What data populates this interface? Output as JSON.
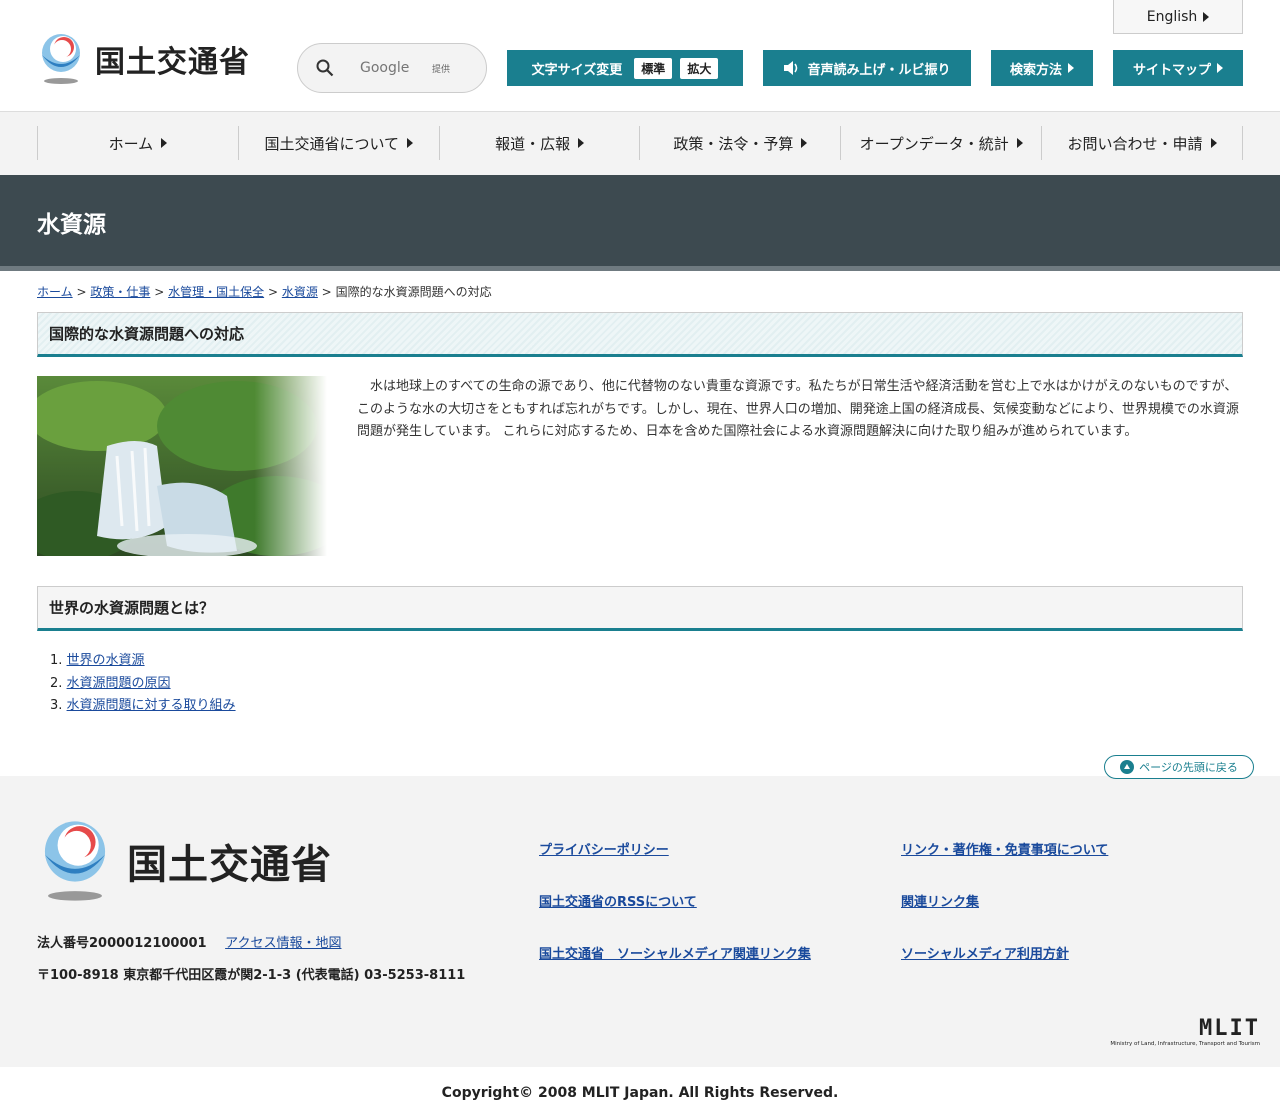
{
  "header": {
    "logo_text": "国土交通省",
    "english_label": "English",
    "search_placeholder": "Google",
    "search_provided": "提供",
    "font_size_label": "文字サイズ変更",
    "font_standard": "標準",
    "font_large": "拡大",
    "speech_label": "音声読み上げ・ルビ振り",
    "search_method_label": "検索方法",
    "sitemap_label": "サイトマップ"
  },
  "gnav": [
    {
      "label": "ホーム"
    },
    {
      "label": "国土交通省について"
    },
    {
      "label": "報道・広報"
    },
    {
      "label": "政策・法令・予算"
    },
    {
      "label": "オープンデータ・統計"
    },
    {
      "label": "お問い合わせ・申請"
    }
  ],
  "page_title": "水資源",
  "breadcrumb": {
    "items": [
      "ホーム",
      "政策・仕事",
      "水管理・国土保全",
      "水資源"
    ],
    "separator": ">",
    "current": "国際的な水資源問題への対応"
  },
  "section1": {
    "heading": "国際的な水資源問題への対応",
    "body": "水は地球上のすべての生命の源であり、他に代替物のない貴重な資源です。私たちが日常生活や経済活動を営む上で水はかけがえのないものですが、このような水の大切さをともすれば忘れがちです。しかし、現在、世界人口の増加、開発途上国の経済成長、気候変動などにより、世界規模での水資源問題が発生しています。 これらに対応するため、日本を含めた国際社会による水資源問題解決に向けた取り組みが進められています。"
  },
  "section2": {
    "heading": "世界の水資源問題とは？",
    "items": [
      {
        "num": "1.",
        "label": "世界の水資源 "
      },
      {
        "num": "2.",
        "label": "水資源問題の原因"
      },
      {
        "num": "3.",
        "label": "水資源問題に対する取り組み"
      }
    ]
  },
  "back_to_top": "ページの先頭に戻る",
  "footer": {
    "logo_text": "国土交通省",
    "corp_number": "法人番号2000012100001",
    "access_link": "アクセス情報・地図",
    "address": "〒100-8918 東京都千代田区霞が関2-1-3 (代表電話) 03-5253-8111",
    "links_col1": [
      "プライバシーポリシー",
      "国土交通省のRSSについて",
      "国土交通省　ソーシャルメディア関連リンク集"
    ],
    "links_col2": [
      "リンク・著作権・免責事項について",
      "関連リンク集",
      "ソーシャルメディア利用方針"
    ],
    "mlit_logo": "MLIT",
    "mlit_sub": "Ministry of Land, Infrastructure, Transport and Tourism"
  },
  "copyright": "Copyright© 2008 MLIT Japan. All Rights Reserved.",
  "colors": {
    "teal": "#1a7f8f",
    "title_band": "#3d4a50",
    "link": "#1a4a9c"
  }
}
